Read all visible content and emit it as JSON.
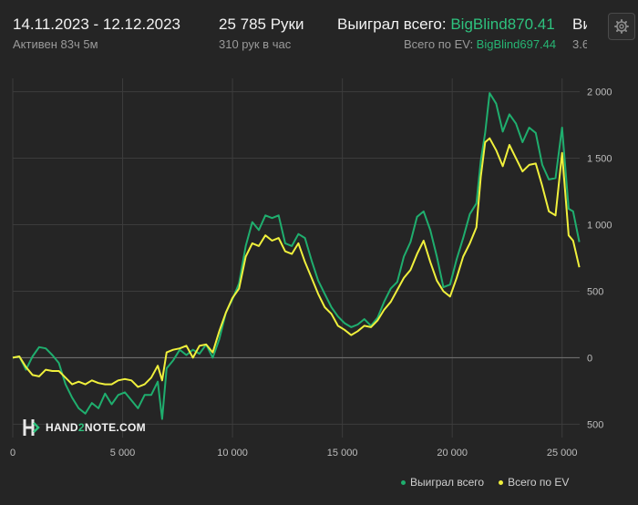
{
  "header": {
    "date_range": "14.11.2023 - 12.12.2023",
    "active_time": "Активен 83ч 5м",
    "hands_count": "25 785 Руки",
    "hands_rate": "310 рук в час",
    "won_total_label": "Выиграл всего: ",
    "won_total_value": "BigBlind870.41",
    "ev_total_label": "Всего по EV: ",
    "ev_total_value": "BigBlind697.44",
    "cut_top": "Ви",
    "cut_bottom": "3.6"
  },
  "brand": {
    "name_a": "HAND",
    "name_num": "2",
    "name_b": "NOTE.COM"
  },
  "colors": {
    "won": "#1fae6e",
    "ev": "#f0f03c",
    "grid": "#3c3c3c",
    "zero": "#6e6e6e"
  },
  "chart_data": {
    "type": "line",
    "x_ticks": [
      "0",
      "5 000",
      "10 000",
      "15 000",
      "20 000",
      "25 000"
    ],
    "x_tick_values": [
      0,
      5000,
      10000,
      15000,
      20000,
      25000
    ],
    "y_ticks": [
      "2 000",
      "1 500",
      "1 000",
      "500",
      "0",
      "500"
    ],
    "y_tick_values": [
      2000,
      1500,
      1000,
      500,
      0,
      -500
    ],
    "xlim": [
      0,
      25800
    ],
    "ylim": [
      -600,
      2100
    ],
    "grid": true,
    "legend_placement": "bottom-right",
    "series": [
      {
        "name": "Выиграл всего",
        "color": "#1fae6e",
        "x": [
          0,
          300,
          600,
          900,
          1200,
          1500,
          1800,
          2100,
          2400,
          2700,
          3000,
          3300,
          3600,
          3900,
          4200,
          4500,
          4800,
          5100,
          5400,
          5700,
          6000,
          6300,
          6600,
          6800,
          7000,
          7300,
          7600,
          7900,
          8200,
          8500,
          8800,
          9100,
          9400,
          9700,
          10000,
          10300,
          10600,
          10900,
          11200,
          11500,
          11800,
          12100,
          12400,
          12700,
          13000,
          13300,
          13600,
          13900,
          14200,
          14500,
          14800,
          15100,
          15400,
          15700,
          16000,
          16300,
          16600,
          16900,
          17200,
          17500,
          17800,
          18100,
          18400,
          18700,
          19000,
          19300,
          19600,
          19900,
          20200,
          20500,
          20800,
          21100,
          21300,
          21500,
          21700,
          22000,
          22300,
          22600,
          22900,
          23200,
          23500,
          23800,
          24100,
          24400,
          24700,
          25000,
          25300,
          25500,
          25785
        ],
        "y": [
          0,
          10,
          -90,
          10,
          80,
          70,
          20,
          -40,
          -200,
          -300,
          -380,
          -420,
          -340,
          -380,
          -270,
          -350,
          -280,
          -260,
          -320,
          -380,
          -280,
          -280,
          -180,
          -460,
          -80,
          -20,
          60,
          20,
          60,
          30,
          100,
          0,
          140,
          340,
          440,
          560,
          840,
          1020,
          960,
          1070,
          1050,
          1070,
          860,
          840,
          930,
          900,
          730,
          580,
          480,
          380,
          310,
          260,
          230,
          250,
          290,
          240,
          300,
          420,
          520,
          570,
          760,
          870,
          1060,
          1100,
          960,
          760,
          530,
          550,
          740,
          900,
          1080,
          1160,
          1480,
          1690,
          1990,
          1910,
          1700,
          1830,
          1760,
          1620,
          1730,
          1690,
          1450,
          1340,
          1350,
          1730,
          1120,
          1100,
          870
        ]
      },
      {
        "name": "Всего по EV",
        "color": "#f0f03c",
        "x": [
          0,
          300,
          600,
          900,
          1200,
          1500,
          1800,
          2100,
          2400,
          2700,
          3000,
          3300,
          3600,
          3900,
          4200,
          4500,
          4800,
          5100,
          5400,
          5700,
          6000,
          6300,
          6600,
          6800,
          7000,
          7300,
          7600,
          7900,
          8200,
          8500,
          8800,
          9100,
          9400,
          9700,
          10000,
          10300,
          10600,
          10900,
          11200,
          11500,
          11800,
          12100,
          12400,
          12700,
          13000,
          13300,
          13600,
          13900,
          14200,
          14500,
          14800,
          15100,
          15400,
          15700,
          16000,
          16300,
          16600,
          16900,
          17200,
          17500,
          17800,
          18100,
          18400,
          18700,
          19000,
          19300,
          19600,
          19900,
          20200,
          20500,
          20800,
          21100,
          21300,
          21500,
          21700,
          22000,
          22300,
          22600,
          22900,
          23200,
          23500,
          23800,
          24100,
          24400,
          24700,
          25000,
          25300,
          25500,
          25785
        ],
        "y": [
          0,
          10,
          -70,
          -130,
          -140,
          -90,
          -100,
          -100,
          -150,
          -200,
          -180,
          -200,
          -170,
          -190,
          -200,
          -200,
          -170,
          -160,
          -170,
          -220,
          -200,
          -150,
          -60,
          -170,
          40,
          60,
          70,
          90,
          0,
          90,
          100,
          40,
          200,
          340,
          450,
          520,
          760,
          860,
          840,
          920,
          880,
          900,
          800,
          780,
          860,
          720,
          600,
          480,
          380,
          330,
          240,
          210,
          170,
          200,
          240,
          230,
          280,
          360,
          420,
          510,
          600,
          660,
          780,
          880,
          720,
          580,
          500,
          460,
          600,
          760,
          860,
          980,
          1360,
          1620,
          1650,
          1560,
          1440,
          1600,
          1500,
          1400,
          1450,
          1460,
          1290,
          1100,
          1070,
          1540,
          920,
          880,
          680
        ]
      }
    ]
  }
}
